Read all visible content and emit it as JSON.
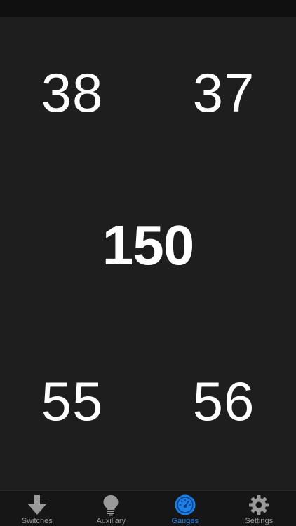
{
  "gauges": {
    "top_left": "38",
    "top_right": "37",
    "center": "150",
    "bottom_left": "55",
    "bottom_right": "56"
  },
  "tab_bar": {
    "active_tab": "gauges",
    "active_color": "#1f7fe8",
    "inactive_color": "#9a9a9a",
    "tabs": [
      {
        "label": "Switches",
        "icon": "down-arrow-icon"
      },
      {
        "label": "Auxiliary",
        "icon": "lightbulb-icon"
      },
      {
        "label": "Gauges",
        "icon": "speedometer-icon"
      },
      {
        "label": "Settings",
        "icon": "gear-icon"
      }
    ]
  }
}
